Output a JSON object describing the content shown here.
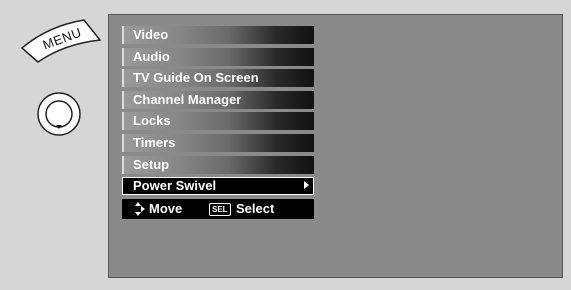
{
  "remote": {
    "menu_key_label": "MENU"
  },
  "menu": {
    "items": [
      {
        "label": "Video",
        "selected": false
      },
      {
        "label": "Audio",
        "selected": false
      },
      {
        "label": "TV Guide On Screen",
        "selected": false
      },
      {
        "label": "Channel Manager",
        "selected": false
      },
      {
        "label": "Locks",
        "selected": false
      },
      {
        "label": "Timers",
        "selected": false
      },
      {
        "label": "Setup",
        "selected": false
      },
      {
        "label": "Power Swivel",
        "selected": true
      }
    ]
  },
  "help": {
    "move_label": "Move",
    "sel_key_label": "SEL",
    "select_label": "Select"
  },
  "colors": {
    "screen_bg": "#8a8a8a",
    "page_bg": "#d6d6d6",
    "selected_bg": "#000000",
    "text": "#ffffff"
  },
  "icons": [
    "menu-key-icon",
    "jog-dial-icon",
    "submenu-arrow-icon",
    "move-arrows-icon",
    "sel-key-icon"
  ]
}
